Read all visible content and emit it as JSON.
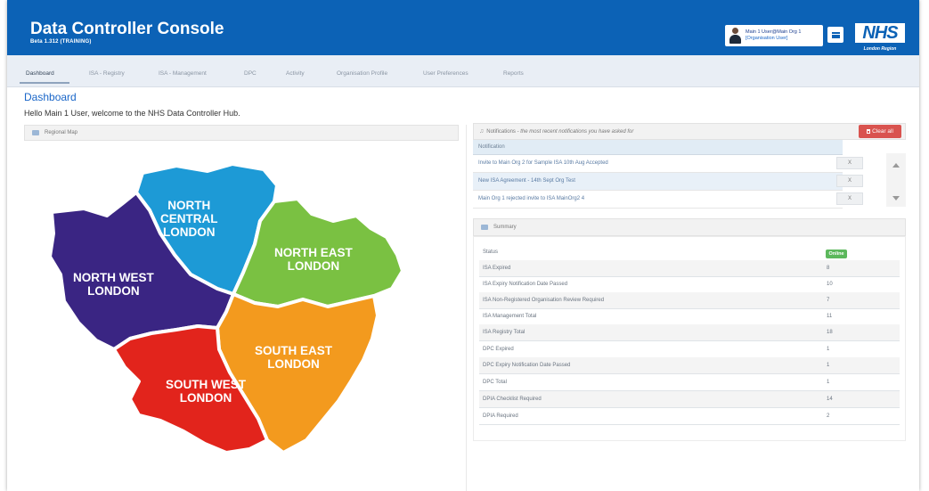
{
  "header": {
    "title": "Data Controller Console",
    "subtitle": "Beta 1.312 (TRAINING)",
    "user_name": "Main 1 User@Main Org 1",
    "user_role": "[Organisation User]",
    "nhs_logo": "NHS",
    "nhs_region": "London Region",
    "brand_color": "#0c62b6"
  },
  "nav": {
    "tabs": [
      {
        "label": "Dashboard",
        "active": true
      },
      {
        "label": "ISA - Registry"
      },
      {
        "label": "ISA - Management"
      },
      {
        "label": "DPC"
      },
      {
        "label": "Activity"
      },
      {
        "label": "Organisation Profile"
      },
      {
        "label": "User Preferences"
      },
      {
        "label": "Reports"
      }
    ]
  },
  "page": {
    "title": "Dashboard",
    "welcome": "Hello Main 1 User, welcome to the NHS Data Controller Hub."
  },
  "map": {
    "header": "Regional Map",
    "regions": [
      {
        "name": "NORTH\nCENTRAL\nLONDON",
        "color": "#1d9ad6"
      },
      {
        "name": "NORTH EAST\nLONDON",
        "color": "#7ac142"
      },
      {
        "name": "NORTH WEST\nLONDON",
        "color": "#3a2583"
      },
      {
        "name": "SOUTH EAST\nLONDON",
        "color": "#f39a1e"
      },
      {
        "name": "SOUTH WEST\nLONDON",
        "color": "#e2241c"
      }
    ]
  },
  "notifications": {
    "header_prefix": "Notifications - ",
    "header_note": "the most recent notifications you have asked for",
    "clear_label": "Clear all",
    "column_header": "Notification",
    "dismiss_label": "X",
    "items": [
      "Invite to Main Org 2 for Sample ISA 10th Aug Accepted",
      "New ISA Agreement - 14th Sept Org Test",
      "Main Org 1 rejected invite to ISA MainOrg2 4"
    ]
  },
  "summary": {
    "header": "Summary",
    "status_label": "Status",
    "status_value": "Online",
    "rows": [
      {
        "label": "ISA Expired",
        "value": "8"
      },
      {
        "label": "ISA Expiry Notification Date Passed",
        "value": "10"
      },
      {
        "label": "ISA Non-Registered Organisation Review Required",
        "value": "7"
      },
      {
        "label": "ISA Management Total",
        "value": "11"
      },
      {
        "label": "ISA Registry Total",
        "value": "18"
      },
      {
        "label": "DPC Expired",
        "value": "1"
      },
      {
        "label": "DPC Expiry Notification Date Passed",
        "value": "1"
      },
      {
        "label": "DPC Total",
        "value": "1"
      },
      {
        "label": "DPIA Checklist Required",
        "value": "14"
      },
      {
        "label": "DPIA Required",
        "value": "2"
      }
    ]
  }
}
